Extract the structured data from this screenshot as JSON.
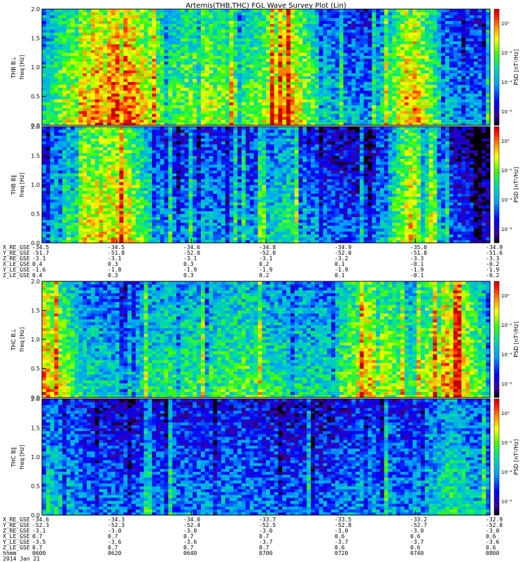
{
  "title": "Artemis(THB,THC) FGL Wave Survey Plot (Lin)",
  "colors": {
    "frame": "#000000",
    "background": "#ffffff"
  },
  "colorbar_labels": {
    "unit": "PSD [nT²/Hz]",
    "ticks": [
      "10⁰",
      "10⁻²",
      "10⁻⁴",
      "10⁻⁶"
    ]
  },
  "ephem_rows": {
    "probe_b": [
      "X_RE_GSE",
      "Y_RE_GSE",
      "Z_RE_GSE",
      "X_LE_GSE",
      "Y_LE_GSE",
      "Z_LE_GSE"
    ],
    "probe_c": [
      "X_RE_GSE",
      "Y_RE_GSE",
      "Z_RE_GSE",
      "X_LE_GSE",
      "Y_LE_GSE",
      "Z_LE_GSE"
    ]
  },
  "ephem_values": {
    "probe_b": [
      [
        "-34.5",
        "-34.5",
        "-34.6",
        "-34.8",
        "-34.9",
        "-35.0",
        "-34.9"
      ],
      [
        "-51.7",
        "-51.8",
        "-52.0",
        "-52.0",
        "-52.0",
        "-51.8",
        "-51.6"
      ],
      [
        "-3.1",
        "-3.1",
        "-3.1",
        "-3.1",
        "-3.2",
        "-3.3",
        "-3.3"
      ],
      [
        "0.4",
        "0.3",
        "0.3",
        "0.2",
        "0.1",
        "-0.1",
        "-0.2"
      ],
      [
        "-1.6",
        "-1.8",
        "-1.9",
        "-1.9",
        "-1.9",
        "-1.9",
        "-1.9"
      ],
      [
        "0.4",
        "0.3",
        "0.3",
        "0.2",
        "0.1",
        "-0.1",
        "-0.2"
      ]
    ],
    "probe_c": [
      [
        "-34.6",
        "-34.3",
        "-34.0",
        "-33.7",
        "-33.5",
        "-33.2",
        "-32.9"
      ],
      [
        "-52.3",
        "-52.3",
        "-52.4",
        "-52.5",
        "-52.8",
        "-52.7",
        "-52.8"
      ],
      [
        "-3.1",
        "-3.0",
        "-3.0",
        "-3.0",
        "-3.0",
        "-3.0",
        "-3.0"
      ],
      [
        "0.7",
        "0.7",
        "0.7",
        "0.7",
        "0.6",
        "0.6",
        "0.6"
      ],
      [
        "-3.5",
        "-3.6",
        "-3.6",
        "-3.7",
        "-3.7",
        "-3.7",
        "-3.6"
      ],
      [
        "0.7",
        "0.7",
        "0.7",
        "0.7",
        "0.6",
        "0.6",
        "0.6"
      ]
    ]
  },
  "time_axis": {
    "label": "hhmm",
    "date": "2014 Jan 21",
    "ticks": [
      "0600",
      "0620",
      "0640",
      "0700",
      "0720",
      "0740",
      "0800"
    ]
  },
  "chart_data": [
    {
      "type": "heatmap",
      "title": "Artemis(THB,THC) FGL Wave Survey Plot (Lin)",
      "ylabel": "THB B⊥\nfreq [Hz]",
      "ylim": [
        0,
        2.0
      ],
      "yticks": [
        "0.0",
        "0.5",
        "1.0",
        "1.5",
        "2.0"
      ],
      "colorbar_label": "PSD [nT²/Hz]",
      "colorbar_ticks": [
        "10⁰",
        "10⁻²",
        "10⁻⁴",
        "10⁻⁶"
      ],
      "colormap": "rainbow",
      "intensity_bands": [
        0.5,
        0.86,
        0.95,
        0.6,
        0.7,
        0.6,
        0.85,
        0.45,
        0.35,
        0.9,
        0.4,
        0.35
      ]
    },
    {
      "type": "heatmap",
      "ylabel": "THB B∥\nfreq [Hz]",
      "ylim": [
        0,
        2.0
      ],
      "yticks": [
        "0.0",
        "0.5",
        "1.0",
        "1.5",
        "2.0"
      ],
      "colorbar_label": "PSD [nT²/Hz]",
      "colorbar_ticks": [
        "10⁰",
        "10⁻²",
        "10⁻⁴",
        "10⁻⁶"
      ],
      "colormap": "rainbow",
      "intensity_bands": [
        0.35,
        0.75,
        0.8,
        0.35,
        0.4,
        0.35,
        0.55,
        0.3,
        0.25,
        0.8,
        0.3,
        0.15
      ]
    },
    {
      "type": "heatmap",
      "ylabel": "THC B⊥\nfreq [Hz]",
      "ylim": [
        0,
        2.0
      ],
      "yticks": [
        "0.0",
        "0.5",
        "1.0",
        "1.5",
        "2.0"
      ],
      "colorbar_label": "PSD [nT²/Hz]",
      "colorbar_ticks": [
        "10⁰",
        "10⁻²",
        "10⁻⁴",
        "10⁻⁶"
      ],
      "colormap": "rainbow",
      "intensity_bands": [
        0.85,
        0.5,
        0.45,
        0.55,
        0.55,
        0.6,
        0.5,
        0.5,
        0.8,
        0.55,
        0.9,
        0.5
      ]
    },
    {
      "type": "heatmap",
      "ylabel": "THC B∥\nfreq [Hz]",
      "ylim": [
        0,
        2.0
      ],
      "yticks": [
        "0.0",
        "0.5",
        "1.0",
        "1.5",
        "2.0"
      ],
      "colorbar_label": "PSD [nT²/Hz]",
      "colorbar_ticks": [
        "10⁰",
        "10⁻²",
        "10⁻⁴",
        "10⁻⁶"
      ],
      "colormap": "rainbow",
      "intensity_bands": [
        0.5,
        0.35,
        0.3,
        0.35,
        0.35,
        0.35,
        0.3,
        0.3,
        0.4,
        0.35,
        0.55,
        0.35
      ]
    }
  ]
}
